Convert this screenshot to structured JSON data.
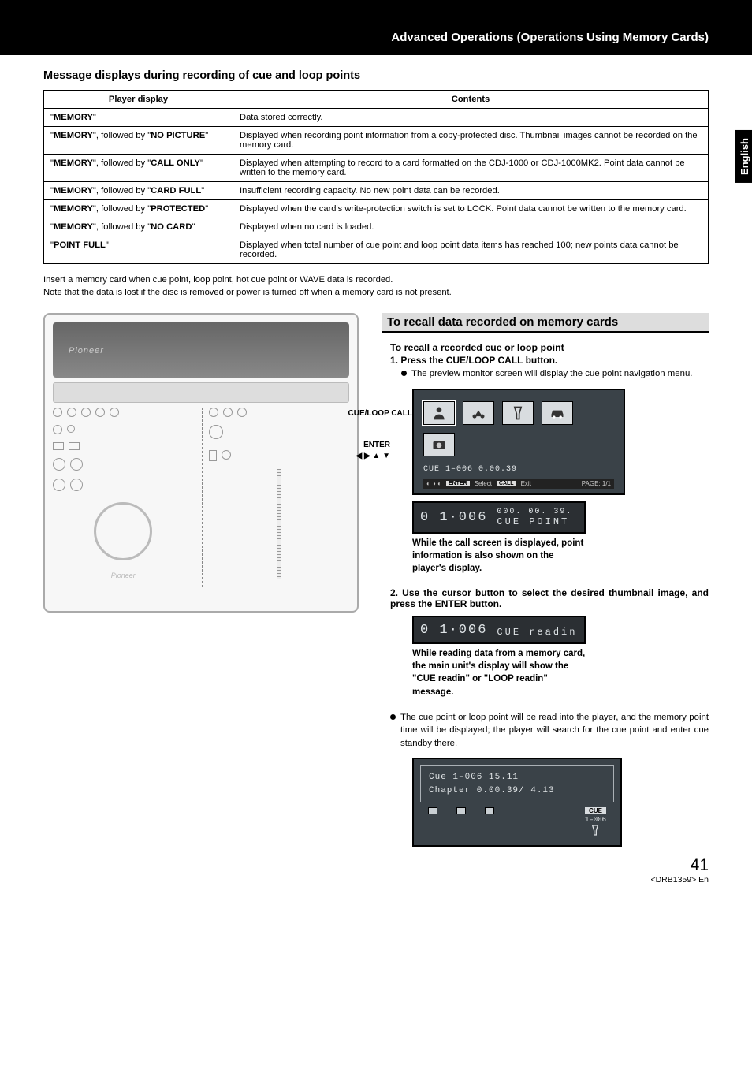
{
  "header": {
    "title": "Advanced Operations (Operations Using Memory Cards)"
  },
  "sideTab": "English",
  "section1": {
    "title": "Message displays during recording of cue and loop points",
    "th1": "Player display",
    "th2": "Contents",
    "rows": [
      {
        "d": "\"MEMORY\"",
        "c": "Data stored correctly."
      },
      {
        "d": "\"MEMORY\", followed by \"NO PICTURE\"",
        "c": "Displayed when recording point information from a copy-protected disc. Thumbnail images cannot be recorded on the memory card."
      },
      {
        "d": "\"MEMORY\", followed by \"CALL ONLY\"",
        "c": "Displayed when attempting to record to a card formatted on the CDJ-1000 or CDJ-1000MK2. Point data cannot be written to the memory card."
      },
      {
        "d": "\"MEMORY\", followed by \"CARD FULL\"",
        "c": "Insufficient recording capacity. No new point data can be recorded."
      },
      {
        "d": "\"MEMORY\", followed by \"PROTECTED\"",
        "c": "Displayed when the card's write-protection switch is set to LOCK. Point data cannot be written to the memory card."
      },
      {
        "d": "\"MEMORY\", followed by \"NO CARD\"",
        "c": "Displayed when no card is loaded."
      },
      {
        "d": "\"POINT FULL\"",
        "c": "Displayed when total number of cue point and loop point data items has reached 100; new points data cannot be recorded."
      }
    ],
    "note1": "Insert a memory card when cue point, loop point, hot cue point or WAVE data is recorded.",
    "note2": "Note that the data is lost if the disc is removed or power is turned off when a memory card is not present."
  },
  "device": {
    "brand": "Pioneer",
    "callouts": {
      "cueloop": "CUE/LOOP CALL",
      "enter": "ENTER",
      "arrows": "◀ ▶ ▲ ▼"
    }
  },
  "recall": {
    "h2": "To recall data recorded on memory cards",
    "sub": "To recall a recorded cue or loop point",
    "step1": "1. Press the CUE/LOOP CALL button.",
    "step1b": "The preview monitor screen will display the cue point navigation menu.",
    "screen1": {
      "line": "CUE   1–006   0.00.39",
      "enter": "ENTER",
      "select": "Select",
      "call": "CALL",
      "exit": "Exit",
      "page": "PAGE: 1/1"
    },
    "lcd1": {
      "left": "0 1·006",
      "rightTop": "000. 00. 39.",
      "rightBot": "CUE  POINT"
    },
    "caption1": "While the call screen is displayed, point information is also shown on the player's display.",
    "step2": "2. Use the cursor button to select the desired thumbnail image, and press the ENTER button.",
    "lcd2": {
      "left": "0 1·006",
      "right": "CUE readin"
    },
    "caption2": "While reading data from a memory card, the main unit's display will show the \"CUE readin\" or \"LOOP readin\" message.",
    "post": "The cue point or loop point will be read into the player, and the memory point time will be displayed; the player will search for the cue point and enter cue standby there.",
    "screen2": {
      "l1": "Cue             1–006  15.11",
      "l2": "  Chapter     0.00.39/  4.13",
      "cueLabel": "CUE",
      "cueNum": "1–006"
    }
  },
  "footer": {
    "pageNum": "41",
    "docId": "<DRB1359> En"
  }
}
